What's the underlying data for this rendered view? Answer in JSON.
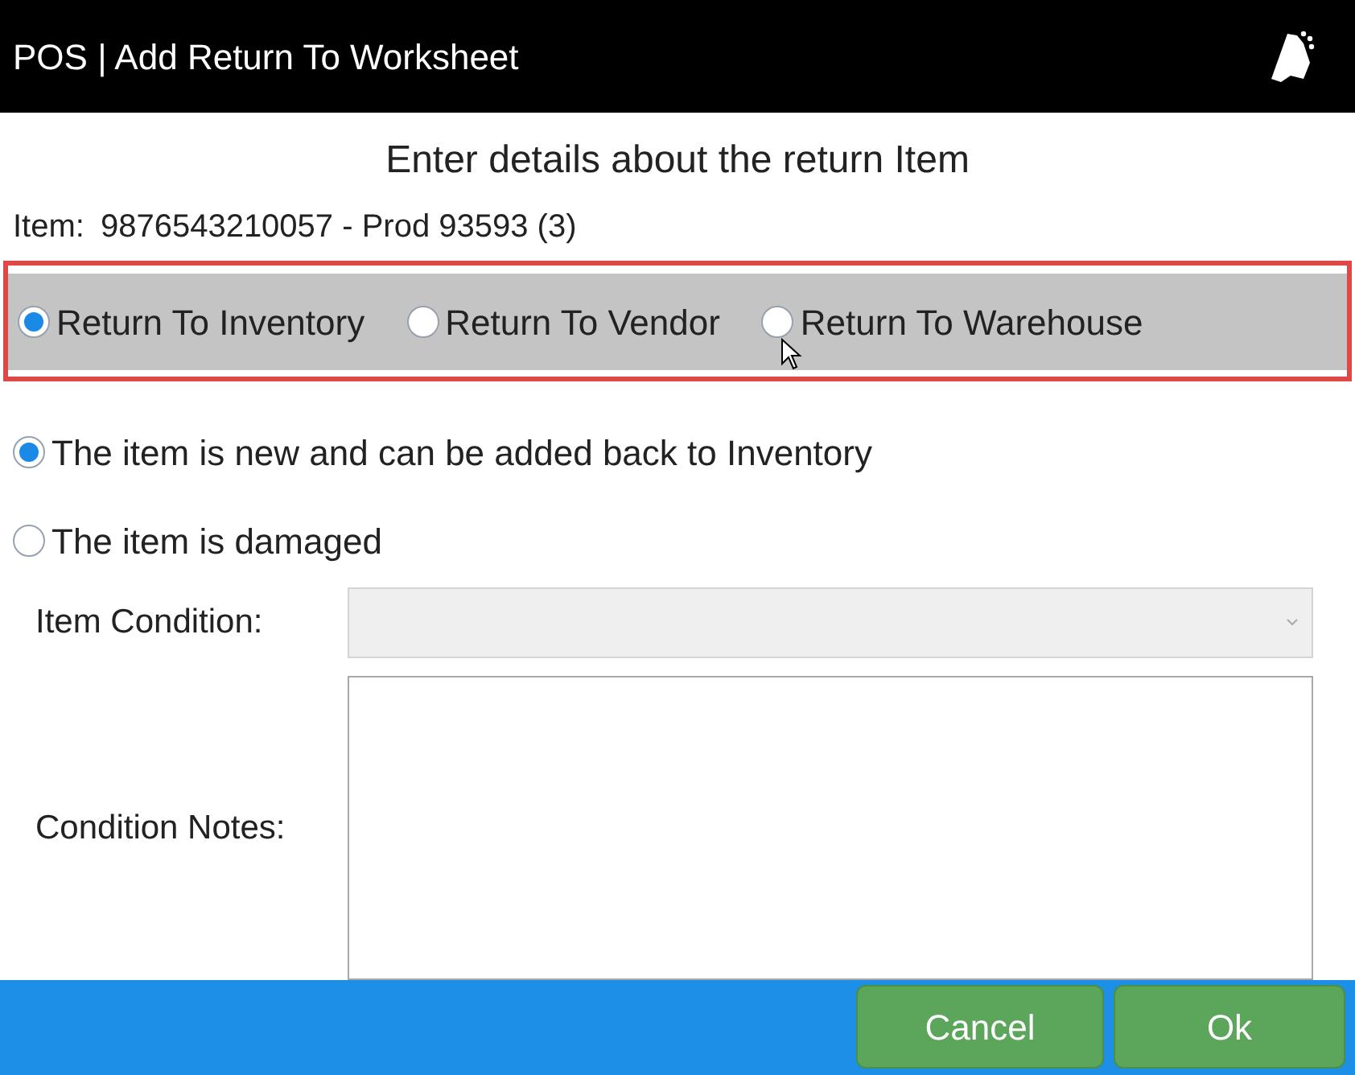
{
  "window": {
    "title": "POS | Add Return To Worksheet"
  },
  "heading": "Enter details about the return Item",
  "item": {
    "label": "Item:",
    "value": "9876543210057 - Prod 93593 (3)"
  },
  "return_options": [
    {
      "label": "Return To Inventory",
      "selected": true
    },
    {
      "label": "Return To Vendor",
      "selected": false
    },
    {
      "label": "Return To Warehouse",
      "selected": false
    }
  ],
  "condition_options": [
    {
      "label": "The item is new and can be added back to Inventory",
      "selected": true
    },
    {
      "label": "The item is damaged",
      "selected": false
    }
  ],
  "item_condition": {
    "label": "Item Condition:",
    "disabled": true
  },
  "condition_notes": {
    "label": "Condition Notes:"
  },
  "buttons": [
    "Cancel",
    "Ok"
  ]
}
